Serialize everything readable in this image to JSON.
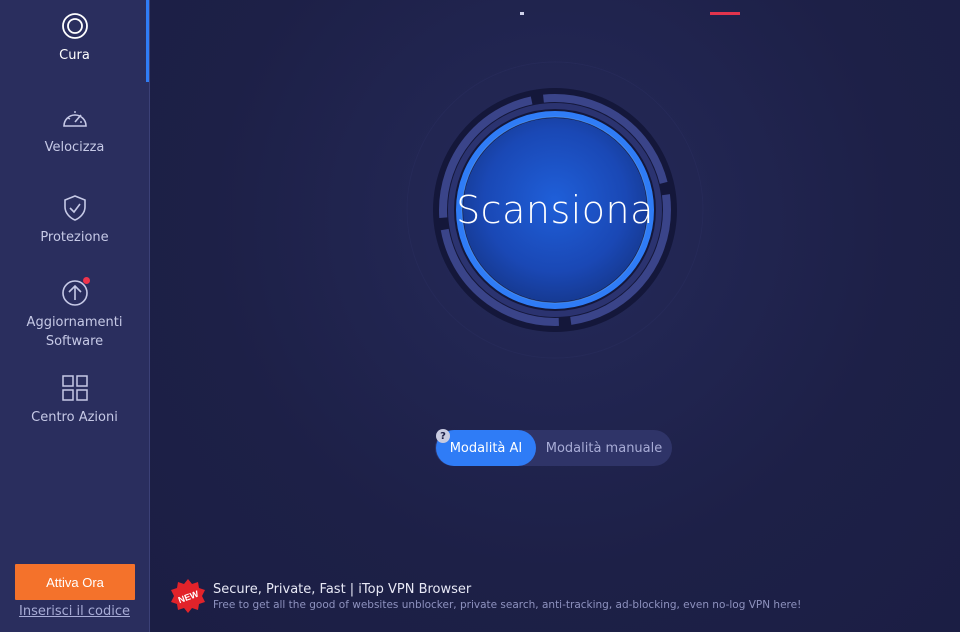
{
  "sidebar": {
    "items": [
      {
        "label": "Cura",
        "icon": "care-icon"
      },
      {
        "label": "Velocizza",
        "icon": "speedometer-icon"
      },
      {
        "label": "Protezione",
        "icon": "shield-check-icon"
      },
      {
        "label": "Aggiornamenti Software",
        "icon": "upgrade-arrow-icon"
      },
      {
        "label": "Centro Azioni",
        "icon": "grid-icon"
      }
    ],
    "activate_label": "Attiva Ora",
    "code_link": "Inserisci il codice"
  },
  "main": {
    "scan_label": "Scansiona",
    "modes": {
      "ai": "Modalità AI",
      "manual": "Modalità manuale",
      "help": "?"
    },
    "promo": {
      "badge": "NEW",
      "title": "Secure, Private, Fast | iTop VPN Browser",
      "subtitle": "Free to get all the good of websites unblocker, private search, anti-tracking, ad-blocking, even no-log VPN here!"
    }
  },
  "colors": {
    "accent": "#2f7cf6",
    "activate": "#f4722b",
    "sidebar_bg": "#2a2e5e",
    "main_bg": "#1d2047",
    "notification": "#f0344c"
  }
}
